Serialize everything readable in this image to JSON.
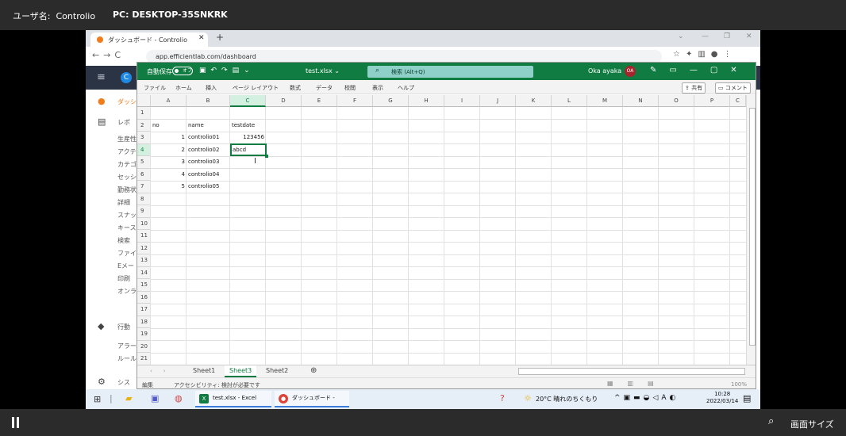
{
  "remote": {
    "user_label": "ユーザ名:",
    "user_name": "Controlio",
    "pc_label": "PC: DESKTOP-35SNKRK",
    "screen_size_label": "画面サイズ"
  },
  "browser": {
    "tab_title": "ダッシュボード - Controlio",
    "url": "app.efficientlab.com/dashboard"
  },
  "app_sidebar": {
    "items": [
      "ダッシ",
      "レポ",
      "生産性",
      "アクテ",
      "カテゴ",
      "セッシ",
      "勤務状",
      "詳細",
      "スナッ",
      "キース",
      "検索",
      "ファイ",
      "Eメー",
      "印刷",
      "オンラ",
      "行動",
      "アラー",
      "ルール",
      "シス"
    ]
  },
  "excel": {
    "autosave": "自動保存",
    "toggle": "オフ",
    "filename": "test.xlsx ⌄",
    "search": "検索 (Alt+Q)",
    "user": "Oka ayaka",
    "initials": "OA",
    "ribbon_tabs": [
      "ファイル",
      "ホーム",
      "挿入",
      "ページ レイアウト",
      "数式",
      "データ",
      "校閲",
      "表示",
      "ヘルプ"
    ],
    "share": "共有",
    "comment": "コメント",
    "columns": [
      "A",
      "B",
      "C",
      "D",
      "E",
      "F",
      "G",
      "H",
      "I",
      "J",
      "K",
      "L",
      "M",
      "N",
      "O",
      "P",
      "C"
    ],
    "rows": [
      "1",
      "2",
      "3",
      "4",
      "5",
      "6",
      "7",
      "8",
      "9",
      "10",
      "11",
      "12",
      "13",
      "14",
      "15",
      "16",
      "17",
      "18",
      "19",
      "20",
      "21"
    ],
    "cells": {
      "a2": "no",
      "b2": "name",
      "c2": "testdate",
      "a3": "1",
      "b3": "controlio01",
      "c3": "123456",
      "a4": "2",
      "b4": "controlio02",
      "c4": "abcd",
      "a5": "3",
      "b5": "controlio03",
      "a6": "4",
      "b6": "controlio04",
      "a7": "5",
      "b7": "controlio05"
    },
    "sheets": [
      "Sheet1",
      "Sheet3",
      "Sheet2"
    ],
    "status_mode": "編集",
    "status_access": "アクセシビリティ: 検討が必要です",
    "zoom": "100%"
  },
  "taskbar": {
    "excel_label": "test.xlsx - Excel",
    "chrome_label": "ダッシュボード - Contr...",
    "weather": "20°C 晴れのちくもり",
    "time": "10:28",
    "date": "2022/03/14",
    "ime": "A"
  }
}
